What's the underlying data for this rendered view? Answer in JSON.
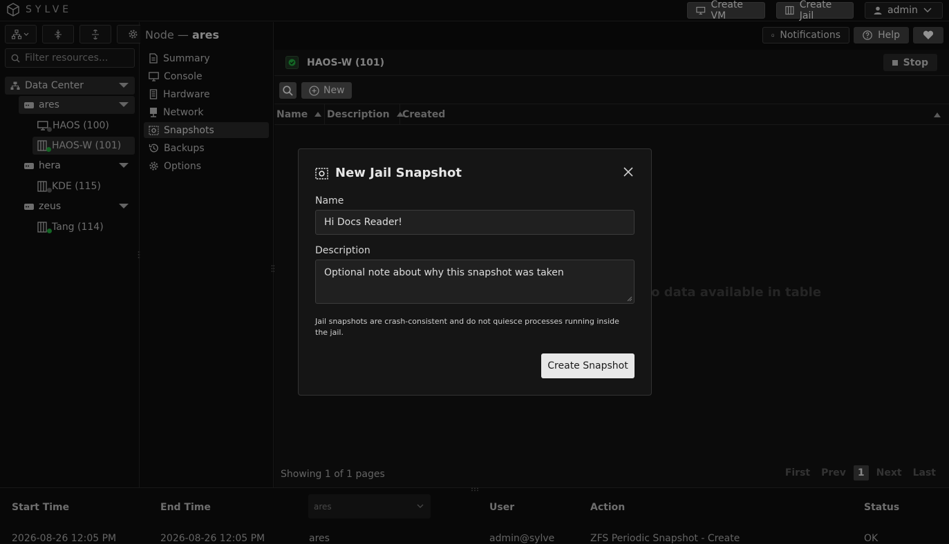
{
  "app": {
    "name": "SYLVE"
  },
  "topbar": {
    "create_vm": "Create VM",
    "create_jail": "Create Jail",
    "user": "admin"
  },
  "sidebar": {
    "filter_placeholder": "Filter resources...",
    "datacenter": "Data Center",
    "nodes": [
      {
        "name": "ares",
        "items": [
          {
            "label": "HAOS (100)",
            "kind": "vm",
            "status": "stopped"
          },
          {
            "label": "HAOS-W (101)",
            "kind": "jail",
            "status": "running"
          }
        ]
      },
      {
        "name": "hera",
        "items": [
          {
            "label": "KDE (115)",
            "kind": "jail",
            "status": "stopped"
          }
        ]
      },
      {
        "name": "zeus",
        "items": [
          {
            "label": "Tang (114)",
            "kind": "jail",
            "status": "running"
          }
        ]
      }
    ]
  },
  "breadcrumb": {
    "prefix": "Node —",
    "node": "ares"
  },
  "menu": [
    "Summary",
    "Console",
    "Hardware",
    "Network",
    "Snapshots",
    "Backups",
    "Options"
  ],
  "header_actions": {
    "notifications": "Notifications",
    "help": "Help"
  },
  "jail": {
    "title": "HAOS-W (101)",
    "stop": "Stop"
  },
  "table": {
    "new": "New",
    "columns": [
      "Name",
      "Description",
      "Created"
    ],
    "empty": "No data available in table",
    "pager_text": "Showing 1 of 1 pages",
    "pager": [
      "First",
      "Prev",
      "1",
      "Next",
      "Last"
    ]
  },
  "modal": {
    "title": "New Jail Snapshot",
    "name_label": "Name",
    "name_value": "Hi Docs Reader!",
    "description_label": "Description",
    "description_value": "Optional note about why this snapshot was taken",
    "hint": "Jail snapshots are crash-consistent and do not quiesce processes running inside the jail.",
    "submit": "Create Snapshot"
  },
  "tasks": {
    "headers": [
      "Start Time",
      "End Time",
      "User",
      "Action",
      "Status"
    ],
    "node_filter": "ares",
    "row": [
      "2026-08-26 12:05 PM",
      "2026-08-26 12:05 PM",
      "ares",
      "admin@sylve",
      "ZFS Periodic Snapshot - Create",
      "OK"
    ]
  },
  "colors": {
    "running": "#1f9d3a",
    "stopped": "#555555",
    "accent": "#e8e8e8"
  }
}
